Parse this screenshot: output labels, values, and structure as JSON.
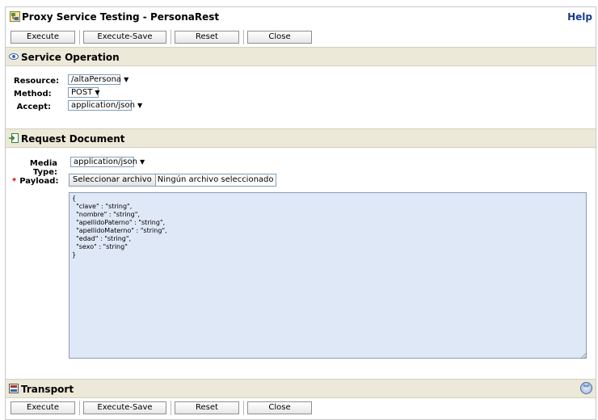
{
  "window": {
    "title": "Proxy Service Testing - PersonaRest",
    "help_label": "Help"
  },
  "toolbar": {
    "execute": "Execute",
    "execute_save": "Execute-Save",
    "reset": "Reset",
    "close": "Close"
  },
  "service_operation": {
    "title": "Service Operation",
    "resource_label": "Resource:",
    "resource_value": "/altaPersona",
    "method_label": "Method:",
    "method_value": "POST",
    "accept_label": "Accept:",
    "accept_value": "application/json"
  },
  "request_document": {
    "title": "Request Document",
    "media_type_label": "Media Type:",
    "media_type_value": "application/json",
    "payload_required": "*",
    "payload_label": "Payload:",
    "file_button": "Seleccionar archivo",
    "file_status": "Ningún archivo seleccionado",
    "payload_text": "{\n  \"clave\" : \"string\",\n  \"nombre\" : \"string\",\n  \"apellidoPaterno\" : \"string\",\n  \"apellidoMaterno\" : \"string\",\n  \"edad\" : \"string\",\n  \"sexo\" : \"string\"\n}"
  },
  "transport": {
    "title": "Transport"
  },
  "icons": {
    "title": "proxy-service-icon",
    "service_operation": "eye-icon",
    "request_document": "arrow-in-icon",
    "transport": "transport-icon",
    "expand": "chevron-down-circle-icon"
  },
  "colors": {
    "section_bg": "#ece9d8",
    "payload_bg": "#dfe8f6",
    "help_link": "#1a3c8c"
  }
}
